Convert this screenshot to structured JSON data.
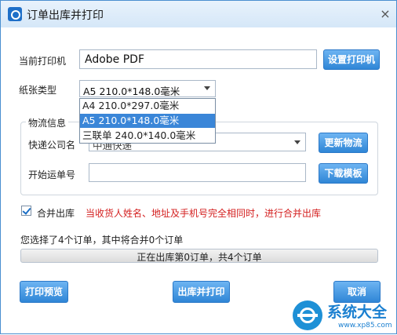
{
  "window": {
    "title": "订单出库并打印",
    "close_glyph": "×"
  },
  "printer": {
    "label": "当前打印机",
    "value": "Adobe PDF",
    "setup_button": "设置打印机"
  },
  "paper": {
    "label": "纸张类型",
    "selected": "A5  210.0*148.0毫米",
    "options": [
      "A4  210.0*297.0毫米",
      "A5  210.0*148.0毫米",
      "三联单  240.0*140.0毫米"
    ],
    "highlighted_index": 1
  },
  "logistics": {
    "group_title": "物流信息",
    "company_label": "快递公司名",
    "company_value": "中通快递",
    "update_button": "更新物流",
    "tracking_label": "开始运单号",
    "tracking_value": "",
    "download_button": "下载模板"
  },
  "merge": {
    "checked": true,
    "label": "合并出库",
    "hint": "当收货人姓名、地址及手机号完全相同时，进行合并出库",
    "hint_color": "#d42020"
  },
  "summary": {
    "text": "您选择了4个订单，其中将合并0个订单"
  },
  "progress": {
    "text": "正在出库第0订单，共4个订单",
    "value": 0
  },
  "actions": {
    "preview": "打印预览",
    "ship_print": "出库并打印",
    "cancel": "取消"
  },
  "watermark": {
    "text": "系统大全",
    "url": "www.xp85.com"
  },
  "colors": {
    "accent": "#3a86d8",
    "button_top": "#6db4f2",
    "button_bottom": "#2f86d6"
  }
}
